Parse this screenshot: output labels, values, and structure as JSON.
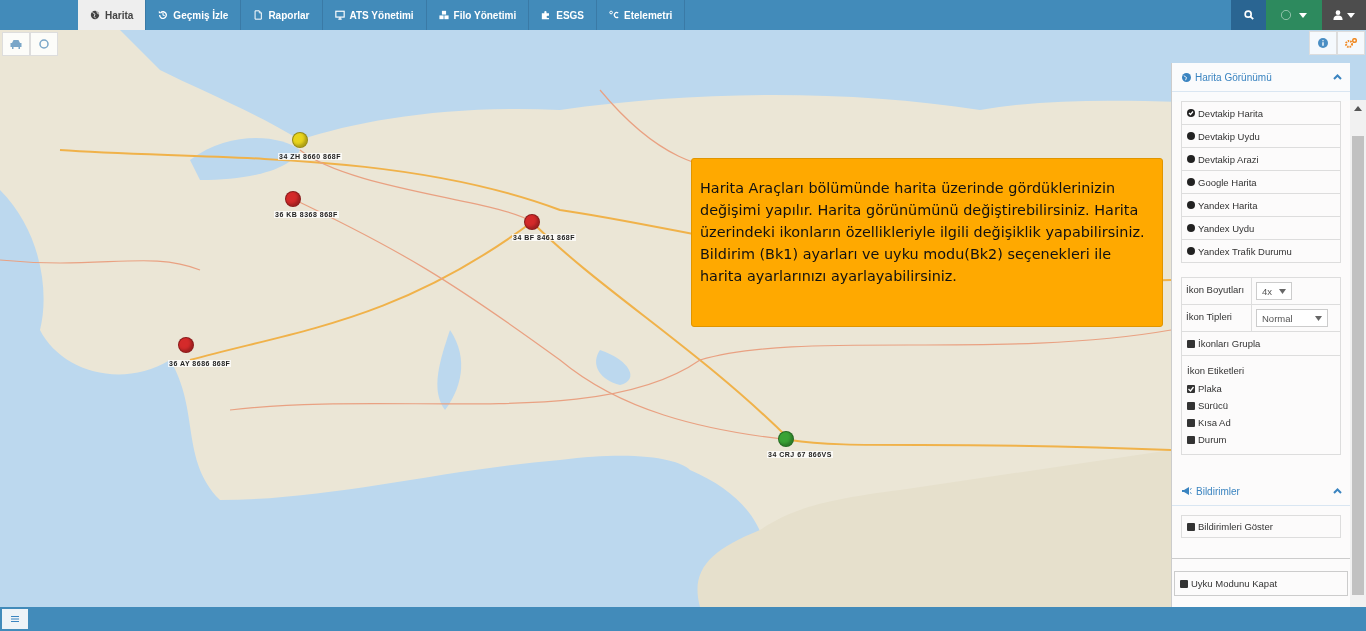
{
  "nav": {
    "tabs": [
      {
        "label": "Harita",
        "selected": true
      },
      {
        "label": "Geçmiş İzle",
        "selected": false
      },
      {
        "label": "Raporlar",
        "selected": false
      },
      {
        "label": "ATS Yönetimi",
        "selected": false
      },
      {
        "label": "Filo Yönetimi",
        "selected": false
      },
      {
        "label": "ESGS",
        "selected": false
      },
      {
        "label": "Etelemetri",
        "selected": false
      }
    ]
  },
  "markers": [
    {
      "label": "34 ZH 8660 868F",
      "color": "#e8d41c"
    },
    {
      "label": "36 KB 8368 868F",
      "color": "#d42a2a"
    },
    {
      "label": "34 BF 8461 868F",
      "color": "#d42a2a"
    },
    {
      "label": "36 AY 8686 868F",
      "color": "#d42a2a"
    },
    {
      "label": "34 CRJ 67 866VS",
      "color": "#3aa335"
    }
  ],
  "tooltip": {
    "text": "Harita Araçları bölümünde harita üzerinde gördüklerinizin değişimi yapılır. Harita görünümünü değiştirebilirsiniz. Harita üzerindeki ikonların özellikleriyle ilgili değişiklik yapabilirsiniz. Bildirim (Bk1) ayarları ve uyku modu(Bk2) seçenekleri ile harita ayarlarınızı ayarlayabilirsiniz."
  },
  "panel": {
    "map_view": {
      "title": "Harita Görünümü",
      "expanded": true,
      "options": [
        {
          "label": "Devtakip Harita",
          "selected": true
        },
        {
          "label": "Devtakip Uydu",
          "selected": false
        },
        {
          "label": "Devtakip Arazi",
          "selected": false
        },
        {
          "label": "Google Harita",
          "selected": false
        },
        {
          "label": "Yandex Harita",
          "selected": false
        },
        {
          "label": "Yandex Uydu",
          "selected": false
        },
        {
          "label": "Yandex Trafik Durumu",
          "selected": false
        }
      ]
    },
    "icon_settings": {
      "size_label": "İkon Boyutları",
      "size_value": "4x",
      "type_label": "İkon Tipleri",
      "type_value": "Normal",
      "group": {
        "label": "İkonları Grupla",
        "checked": false
      },
      "labels_title": "İkon Etiketleri",
      "label_options": [
        {
          "label": "Plaka",
          "checked": true
        },
        {
          "label": "Sürücü",
          "checked": false
        },
        {
          "label": "Kısa Ad",
          "checked": false
        },
        {
          "label": "Durum",
          "checked": false
        }
      ]
    },
    "notifications": {
      "title": "Bildirimler",
      "expanded": true,
      "show": {
        "label": "Bildirimleri Göster",
        "checked": false
      }
    },
    "sleep": {
      "label": "Uyku Modunu Kapat",
      "checked": false
    }
  }
}
